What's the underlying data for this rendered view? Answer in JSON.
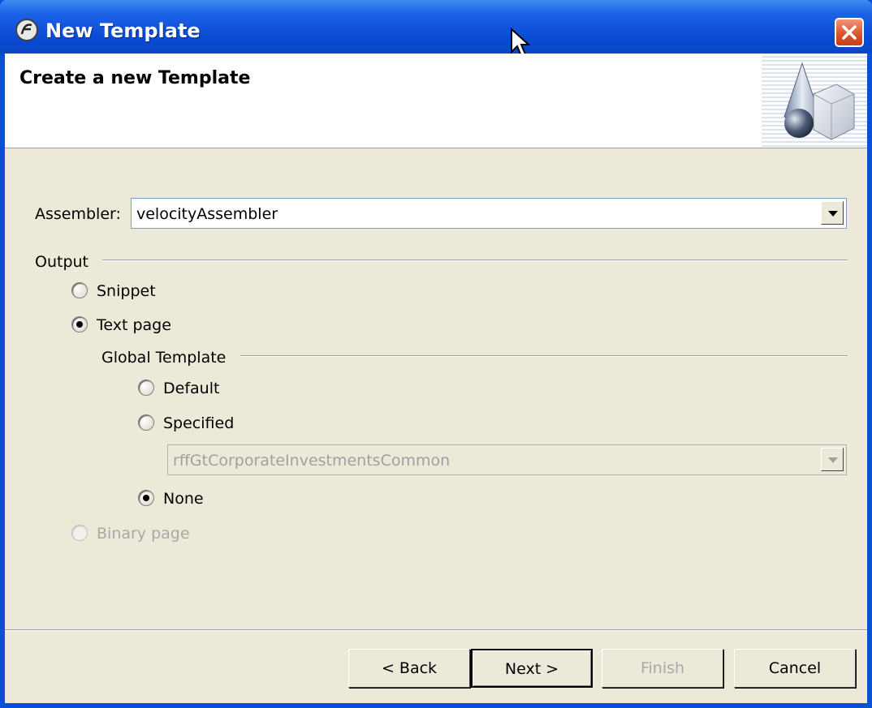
{
  "window": {
    "title": "New Template"
  },
  "banner": {
    "title": "Create a new Template"
  },
  "assembler": {
    "label": "Assembler:",
    "value": "velocityAssembler"
  },
  "output": {
    "group_label": "Output",
    "snippet": "Snippet",
    "text_page": "Text page",
    "binary_page": "Binary page",
    "selected": "Text page"
  },
  "global_template": {
    "group_label": "Global Template",
    "default": "Default",
    "specified": "Specified",
    "specified_value": "rffGtCorporateInvestmentsCommon",
    "none": "None",
    "selected": "None"
  },
  "buttons": {
    "back": "< Back",
    "next": "Next >",
    "finish": "Finish",
    "cancel": "Cancel"
  },
  "icons": {
    "title": "app-logo-icon",
    "close": "close-icon",
    "banner": "shapes-wizard-icon"
  },
  "colors": {
    "titlebar": "#0a4ad4",
    "dialog": "#ece9d8",
    "close": "#d9512a"
  }
}
